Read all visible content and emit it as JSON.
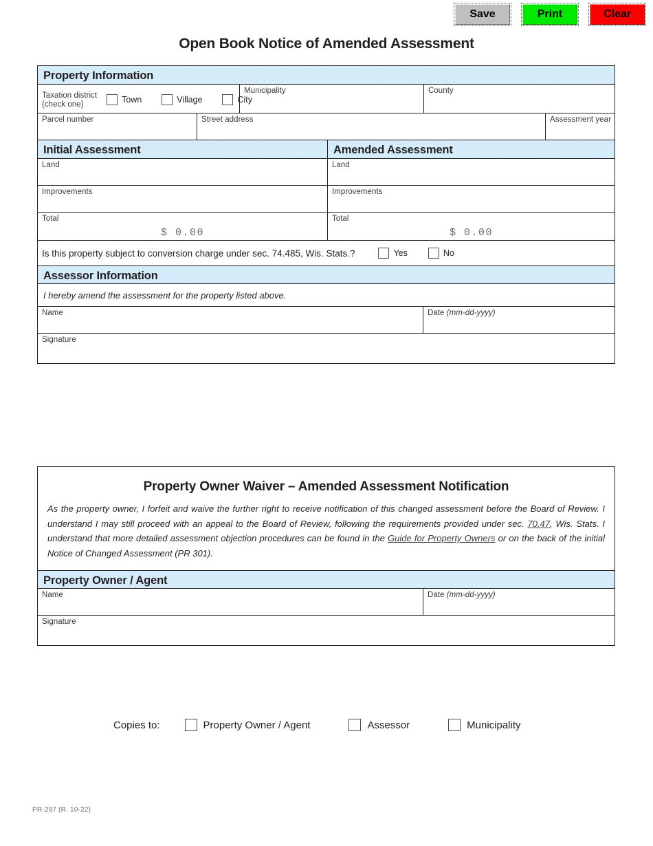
{
  "toolbar": {
    "save_label": "Save",
    "print_label": "Print",
    "clear_label": "Clear"
  },
  "page_title": "Open Book Notice of Amended Assessment",
  "property_information": {
    "section_title": "Property Information",
    "taxation_district_label": "Taxation district",
    "taxation_district_hint": "(check one)",
    "district_options": [
      "Town",
      "Village",
      "City"
    ],
    "municipality_label": "Municipality",
    "county_label": "County",
    "parcel_number_label": "Parcel number",
    "street_address_label": "Street address",
    "assessment_year_label": "Assessment year",
    "field_values": {
      "municipality": "",
      "county": "",
      "parcel_number": "",
      "street_address": "",
      "assessment_year": ""
    }
  },
  "assessment": {
    "initial_title": "Initial Assessment",
    "amended_title": "Amended Assessment",
    "land_label": "Land",
    "improvements_label": "Improvements",
    "total_label": "Total",
    "initial": {
      "land": "",
      "improvements": "",
      "total": "$  0.00"
    },
    "amended": {
      "land": "",
      "improvements": "",
      "total": "$  0.00"
    }
  },
  "conversion_charge": {
    "question": "Is this property subject to conversion charge under sec. 74.485, Wis. Stats.?",
    "yes_label": "Yes",
    "no_label": "No"
  },
  "assessor_information": {
    "section_title": "Assessor Information",
    "statement": "I hereby amend the assessment for the property listed above.",
    "name_label": "Name",
    "date_label": "Date",
    "date_format": "(mm-dd-yyyy)",
    "signature_label": "Signature",
    "field_values": {
      "name": "",
      "date": "",
      "signature": ""
    }
  },
  "waiver": {
    "title": "Property Owner Waiver – Amended Assessment Notification",
    "paragraph_part1": "As the property owner, I forfeit and waive the further right to receive notification of this changed assessment before the Board of Review. I understand I may still proceed with an appeal to the Board of Review, following the requirements provided under sec. ",
    "link_statute": "70.47",
    "paragraph_part2": ", Wis. Stats. I understand that more detailed assessment objection procedures can be found in the ",
    "link_guide": "Guide for Property Owners",
    "paragraph_part3": " or on the back of the initial Notice of Changed Assessment (PR 301)."
  },
  "owner_agent": {
    "section_title": "Property Owner / Agent",
    "name_label": "Name",
    "date_label": "Date",
    "date_format": "(mm-dd-yyyy)",
    "signature_label": "Signature",
    "field_values": {
      "name": "",
      "date": "",
      "signature": ""
    }
  },
  "copies_to": {
    "label": "Copies to:",
    "options": [
      "Property Owner / Agent",
      "Assessor",
      "Municipality"
    ]
  },
  "footer": "PR-297 (R. 10-22)",
  "colors": {
    "band_blue": "#d5ecfa",
    "border": "#231f20",
    "save_bg": "#bfbfbf",
    "print_bg": "#00e800",
    "clear_bg": "#fb0000"
  }
}
